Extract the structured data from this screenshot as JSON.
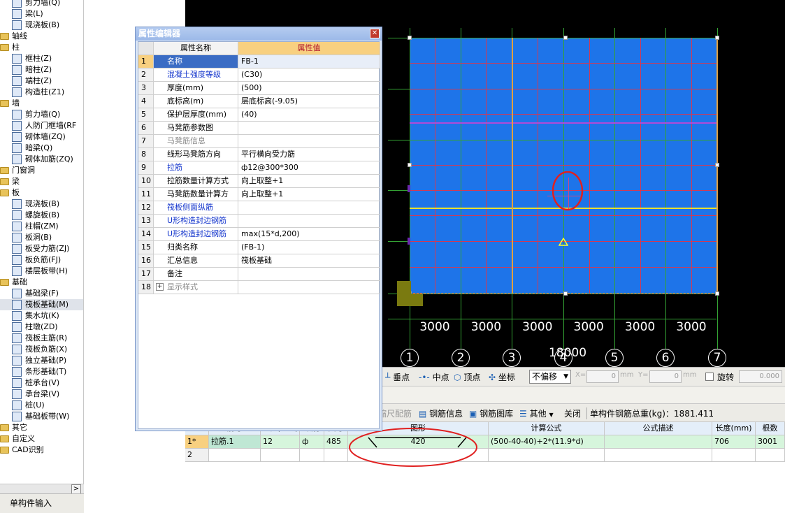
{
  "tree": {
    "items": [
      {
        "label": "剪力墙(Q)",
        "level": 1,
        "kind": "item"
      },
      {
        "label": "梁(L)",
        "level": 1,
        "kind": "item"
      },
      {
        "label": "现浇板(B)",
        "level": 1,
        "kind": "item"
      },
      {
        "label": "轴线",
        "level": 0,
        "kind": "folder"
      },
      {
        "label": "柱",
        "level": 0,
        "kind": "folder"
      },
      {
        "label": "框柱(Z)",
        "level": 1,
        "kind": "item"
      },
      {
        "label": "暗柱(Z)",
        "level": 1,
        "kind": "item"
      },
      {
        "label": "端柱(Z)",
        "level": 1,
        "kind": "item"
      },
      {
        "label": "构造柱(Z1)",
        "level": 1,
        "kind": "item"
      },
      {
        "label": "墙",
        "level": 0,
        "kind": "folder"
      },
      {
        "label": "剪力墙(Q)",
        "level": 1,
        "kind": "item"
      },
      {
        "label": "人防门框墙(RF",
        "level": 1,
        "kind": "item"
      },
      {
        "label": "砌体墙(ZQ)",
        "level": 1,
        "kind": "item"
      },
      {
        "label": "暗梁(Q)",
        "level": 1,
        "kind": "item"
      },
      {
        "label": "砌体加筋(ZQ)",
        "level": 1,
        "kind": "item"
      },
      {
        "label": "门窗洞",
        "level": 0,
        "kind": "folder"
      },
      {
        "label": "梁",
        "level": 0,
        "kind": "folder"
      },
      {
        "label": "板",
        "level": 0,
        "kind": "folder"
      },
      {
        "label": "现浇板(B)",
        "level": 1,
        "kind": "item"
      },
      {
        "label": "螺旋板(B)",
        "level": 1,
        "kind": "item"
      },
      {
        "label": "柱帽(ZM)",
        "level": 1,
        "kind": "item"
      },
      {
        "label": "板洞(B)",
        "level": 1,
        "kind": "item"
      },
      {
        "label": "板受力筋(ZJ)",
        "level": 1,
        "kind": "item"
      },
      {
        "label": "板负筋(FJ)",
        "level": 1,
        "kind": "item"
      },
      {
        "label": "楼层板带(H)",
        "level": 1,
        "kind": "item"
      },
      {
        "label": "基础",
        "level": 0,
        "kind": "folder"
      },
      {
        "label": "基础梁(F)",
        "level": 1,
        "kind": "item"
      },
      {
        "label": "筏板基础(M)",
        "level": 1,
        "kind": "item",
        "selected": true
      },
      {
        "label": "集水坑(K)",
        "level": 1,
        "kind": "item"
      },
      {
        "label": "柱墩(ZD)",
        "level": 1,
        "kind": "item"
      },
      {
        "label": "筏板主筋(R)",
        "level": 1,
        "kind": "item"
      },
      {
        "label": "筏板负筋(X)",
        "level": 1,
        "kind": "item"
      },
      {
        "label": "独立基础(P)",
        "level": 1,
        "kind": "item"
      },
      {
        "label": "条形基础(T)",
        "level": 1,
        "kind": "item"
      },
      {
        "label": "桩承台(V)",
        "level": 1,
        "kind": "item"
      },
      {
        "label": "承台梁(V)",
        "level": 1,
        "kind": "item"
      },
      {
        "label": "桩(U)",
        "level": 1,
        "kind": "item"
      },
      {
        "label": "基础板带(W)",
        "level": 1,
        "kind": "item"
      },
      {
        "label": "其它",
        "level": 0,
        "kind": "folder"
      },
      {
        "label": "自定义",
        "level": 0,
        "kind": "folder"
      },
      {
        "label": "CAD识别",
        "level": 0,
        "kind": "folder"
      }
    ],
    "scroll_right": ">",
    "bottom_tab": "单构件输入"
  },
  "prop_editor": {
    "title": "属性编辑器",
    "close": "✕",
    "col_name": "属性名称",
    "col_value": "属性值",
    "rows": [
      {
        "n": "1",
        "name": "名称",
        "value": "FB-1",
        "style": "sel"
      },
      {
        "n": "2",
        "name": "混凝土强度等级",
        "value": "(C30)",
        "style": "blue"
      },
      {
        "n": "3",
        "name": "厚度(mm)",
        "value": "(500)",
        "style": ""
      },
      {
        "n": "4",
        "name": "底标高(m)",
        "value": "层底标高(-9.05)",
        "style": ""
      },
      {
        "n": "5",
        "name": "保护层厚度(mm)",
        "value": "(40)",
        "style": ""
      },
      {
        "n": "6",
        "name": "马凳筋参数图",
        "value": "",
        "style": ""
      },
      {
        "n": "7",
        "name": "马凳筋信息",
        "value": "",
        "style": "gray"
      },
      {
        "n": "8",
        "name": "线形马凳筋方向",
        "value": "平行横向受力筋",
        "style": ""
      },
      {
        "n": "9",
        "name": "拉筋",
        "value": "ф12@300*300",
        "style": "blue"
      },
      {
        "n": "10",
        "name": "拉筋数量计算方式",
        "value": "向上取整+1",
        "style": ""
      },
      {
        "n": "11",
        "name": "马凳筋数量计算方",
        "value": "向上取整+1",
        "style": ""
      },
      {
        "n": "12",
        "name": "筏板侧面纵筋",
        "value": "",
        "style": "blue"
      },
      {
        "n": "13",
        "name": "U形构造封边钢筋",
        "value": "",
        "style": "blue"
      },
      {
        "n": "14",
        "name": "U形构造封边钢筋",
        "value": "max(15*d,200)",
        "style": "blue"
      },
      {
        "n": "15",
        "name": "归类名称",
        "value": "(FB-1)",
        "style": ""
      },
      {
        "n": "16",
        "name": "汇总信息",
        "value": "筏板基础",
        "style": ""
      },
      {
        "n": "17",
        "name": "备注",
        "value": "",
        "style": ""
      },
      {
        "n": "18",
        "name": "显示样式",
        "value": "",
        "style": "gray",
        "expand": "+"
      }
    ]
  },
  "drawing": {
    "dims": [
      "3000",
      "3000",
      "3000",
      "3000",
      "3000",
      "3000"
    ],
    "total": "18000",
    "axes": [
      "1",
      "2",
      "3",
      "4",
      "5",
      "6",
      "7"
    ]
  },
  "snapbar": {
    "perp": "垂点",
    "mid": "中点",
    "vertex": "顶点",
    "coord": "坐标",
    "offset": "不偏移",
    "x_label": "X=",
    "x_val": "0",
    "y_label": "Y=",
    "y_val": "0",
    "unit": "mm",
    "rotate": "旋转",
    "rot_val": "0.000"
  },
  "rebar_toolbar": {
    "scale_rebar": "缩尺配筋",
    "rebar_info": "钢筋信息",
    "rebar_lib": "钢筋图库",
    "other": "其他",
    "close": "关闭",
    "total": "单构件钢筋总重(kg)：1881.411"
  },
  "grid": {
    "headers": [
      "筋号",
      "直径(mm)",
      "级别",
      "图号",
      "图形",
      "计算公式",
      "公式描述",
      "长度(mm)",
      "根数"
    ],
    "rows": [
      {
        "idx": "1*",
        "name": "拉筋.1",
        "dia": "12",
        "grade": "ф",
        "fig": "485",
        "shape": "420",
        "formula": "(500-40-40)+2*(11.9*d)",
        "desc": "",
        "length": "706",
        "count": "3001"
      },
      {
        "idx": "2",
        "name": "",
        "dia": "",
        "grade": "",
        "fig": "",
        "shape": "",
        "formula": "",
        "desc": "",
        "length": "",
        "count": ""
      }
    ]
  },
  "colors": {
    "slab": "#1e74e9",
    "grid_green": "#34a334",
    "rebar_red": "#d13a55",
    "canvas": "#000000"
  }
}
